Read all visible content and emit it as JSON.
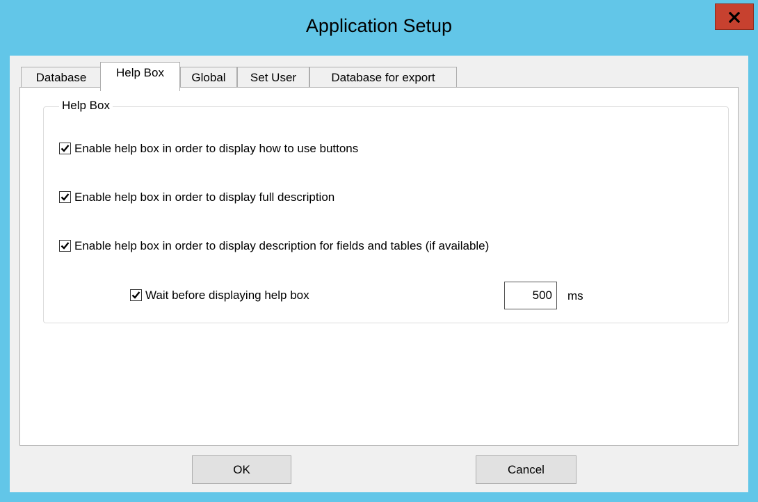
{
  "window": {
    "title": "Application Setup",
    "close_label": "x"
  },
  "tabs": [
    {
      "label": "Database",
      "active": false
    },
    {
      "label": "Help Box",
      "active": true
    },
    {
      "label": "Global",
      "active": false
    },
    {
      "label": "Set User",
      "active": false
    },
    {
      "label": "Database for export",
      "active": false
    }
  ],
  "help_box": {
    "group_title": "Help Box",
    "options": [
      {
        "label": "Enable help box in order to display how to use buttons",
        "checked": true
      },
      {
        "label": "Enable help box in order to display full description",
        "checked": true
      },
      {
        "label": "Enable help box in order to display description for fields and tables (if available)",
        "checked": true
      }
    ],
    "wait": {
      "label": "Wait before displaying help box",
      "checked": true,
      "value": "500",
      "unit": "ms"
    }
  },
  "buttons": {
    "ok_label": "OK",
    "cancel_label": "Cancel"
  },
  "colors": {
    "titlebar": "#62c6e8",
    "close_button": "#c7412f",
    "dialog_background": "#f0f0f0"
  }
}
